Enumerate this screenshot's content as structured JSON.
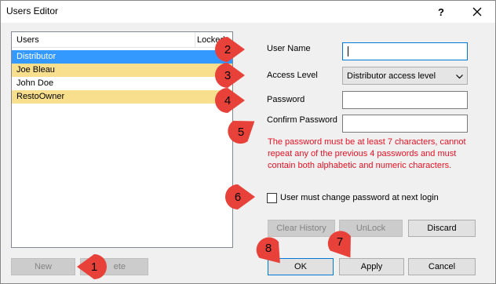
{
  "window": {
    "title": "Users Editor",
    "help_glyph": "?",
    "close_icon": "close-icon"
  },
  "users_list": {
    "col_users": "Users",
    "col_locked": "Locked",
    "rows": [
      {
        "name": "Distributor",
        "state": "selected"
      },
      {
        "name": "Joe Bleau",
        "state": "highlighted"
      },
      {
        "name": "John Doe",
        "state": "normal"
      },
      {
        "name": "RestoOwner",
        "state": "highlighted"
      }
    ]
  },
  "form": {
    "user_name_label": "User Name",
    "user_name_value": "",
    "access_level_label": "Access Level",
    "access_level_value": "Distributor access level",
    "password_label": "Password",
    "password_value": "",
    "confirm_password_label": "Confirm Password",
    "confirm_password_value": "",
    "password_note": "The password must be at least 7 characters, cannot repeat any of the previous 4 passwords and must contain both alphabetic and numeric characters.",
    "must_change_label": "User must change password at next login",
    "must_change_checked": false
  },
  "buttons": {
    "new": "New",
    "delete": "ete",
    "clear_history": "Clear History",
    "unlock": "UnLock",
    "discard": "Discard",
    "ok": "OK",
    "apply": "Apply",
    "cancel": "Cancel"
  },
  "annotations": {
    "pin_1": "1",
    "pin_2": "2",
    "pin_3": "3",
    "pin_4": "4",
    "pin_5": "5",
    "pin_6": "6",
    "pin_7": "7",
    "pin_8": "8"
  },
  "colors": {
    "selection": "#3399ff",
    "row_highlight": "#f7df8e",
    "annotation_pin": "#e8413a",
    "note_text": "#e81123"
  }
}
